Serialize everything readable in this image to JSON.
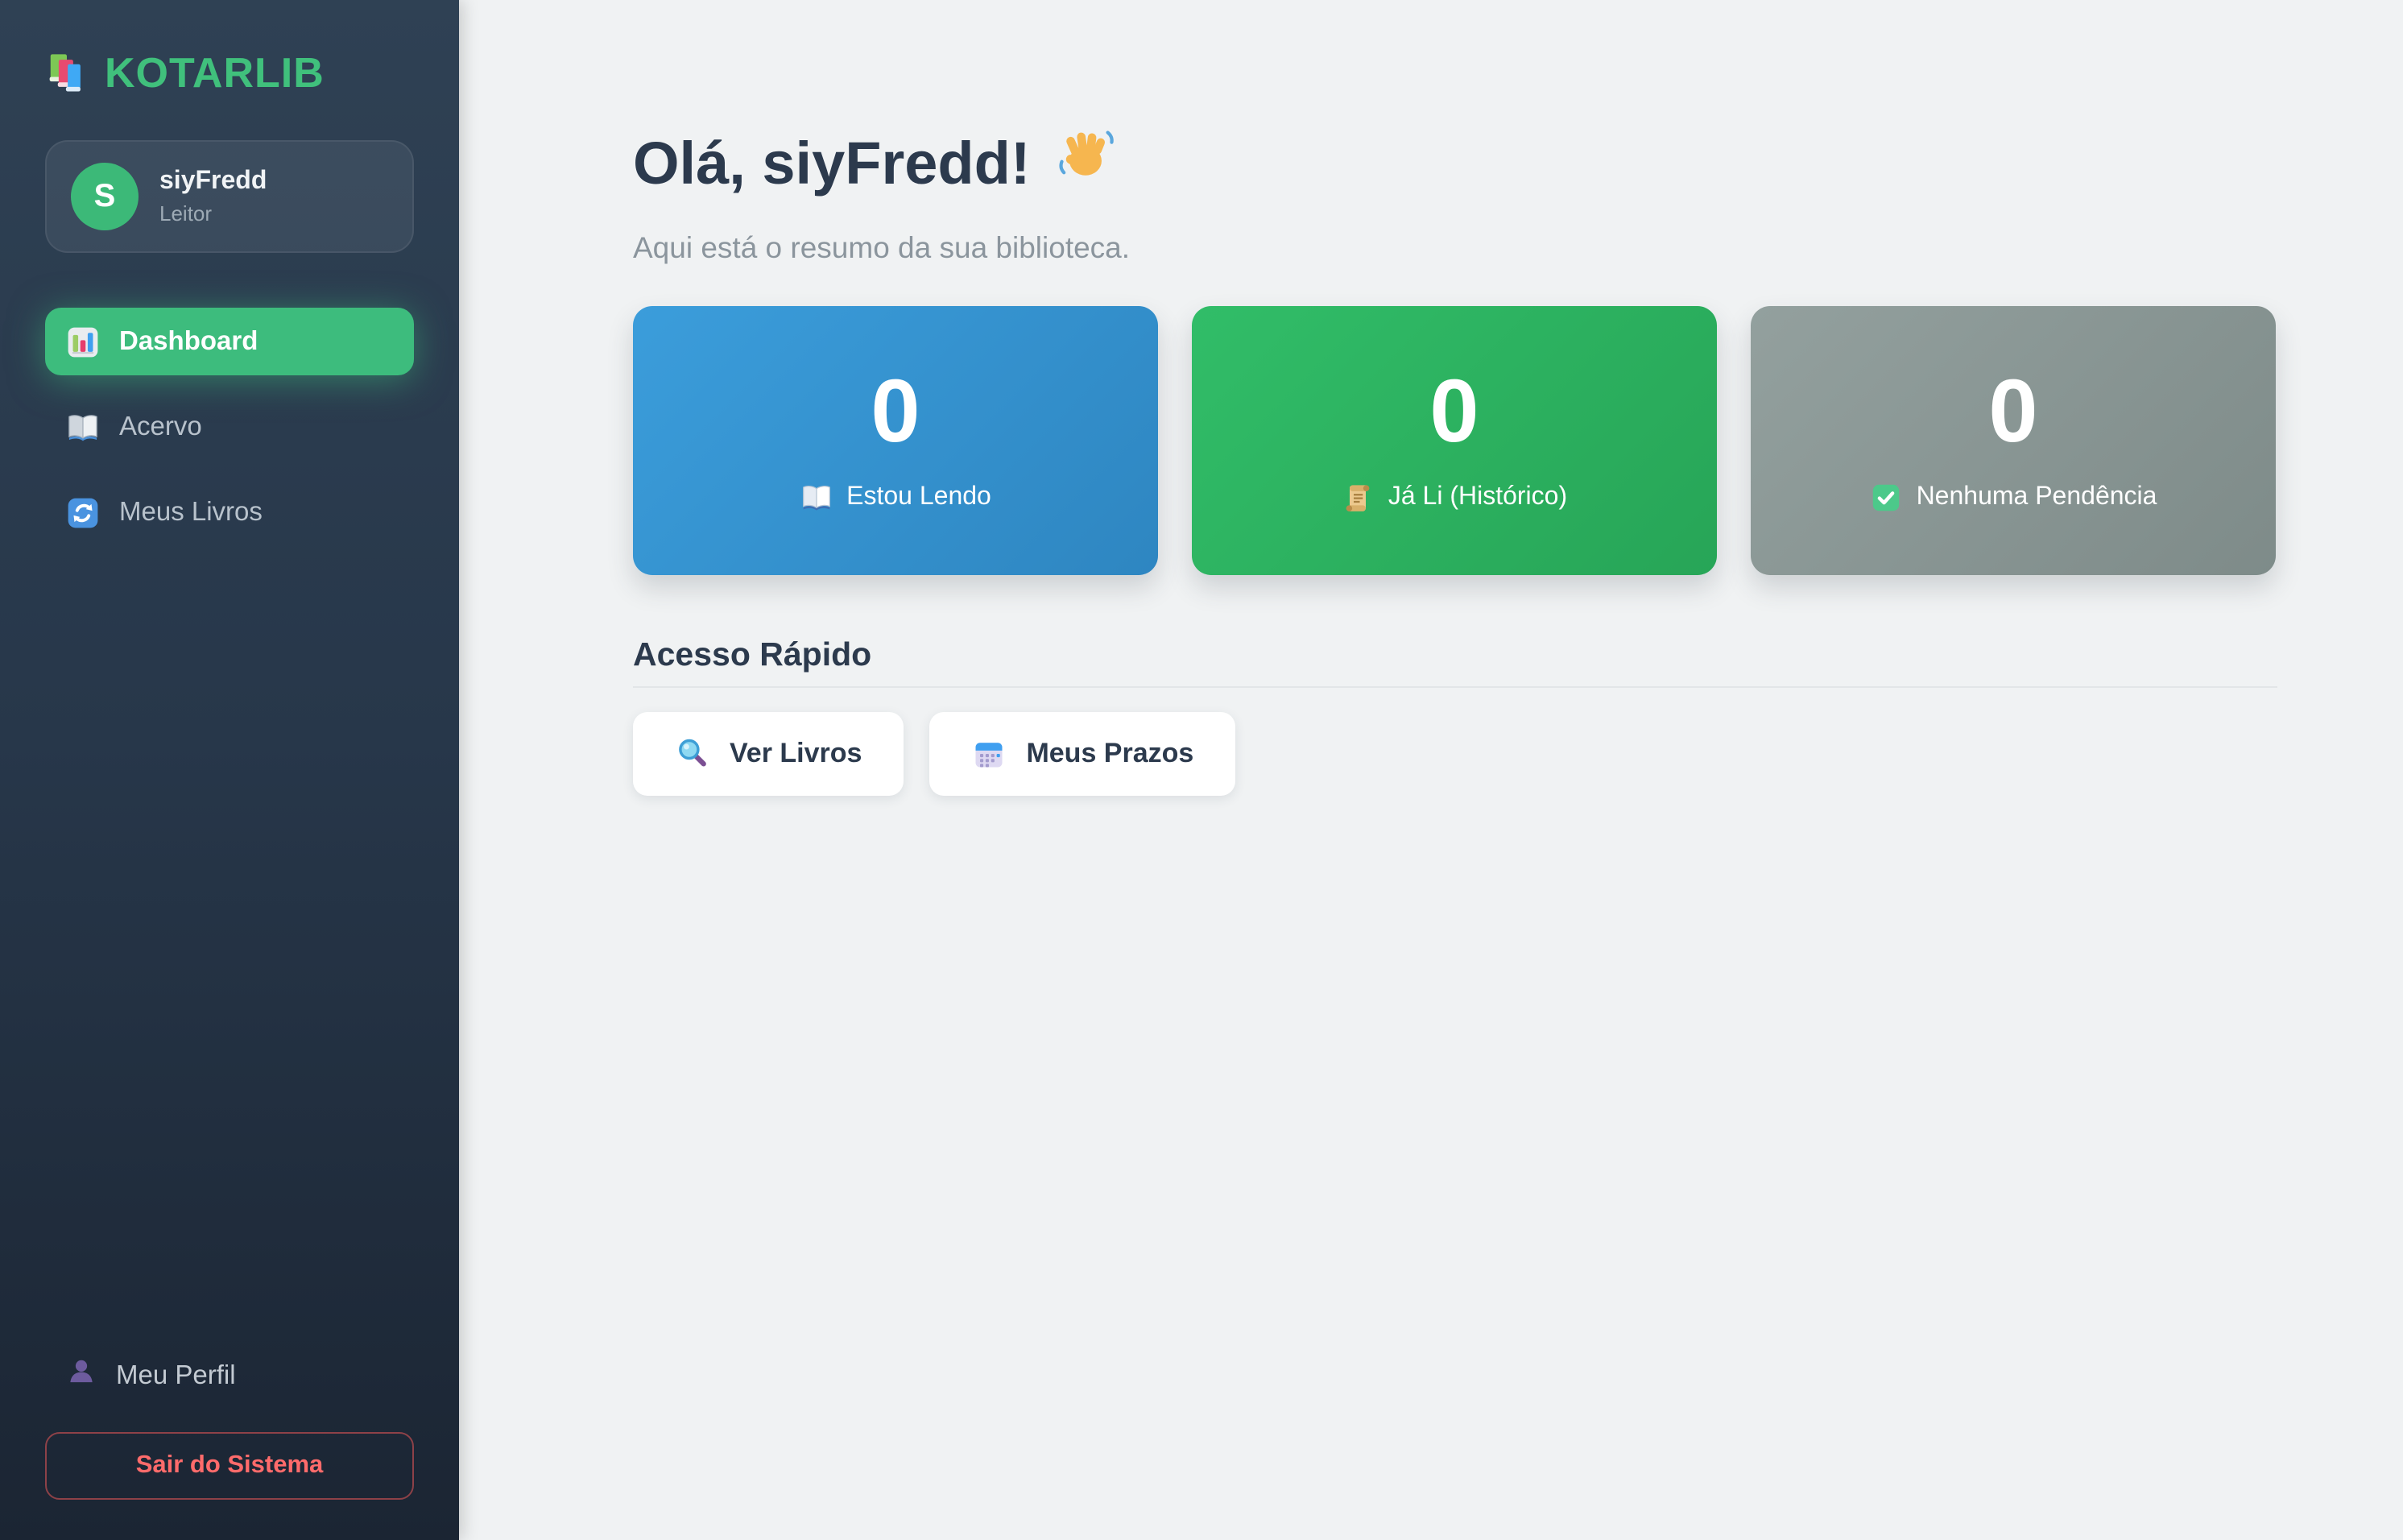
{
  "app": {
    "name": "KOTARLIB",
    "logo_icon": "books-stack-icon"
  },
  "colors": {
    "brand_green": "#40c07c",
    "active_nav_green": "#3dbc7d",
    "avatar_green": "#3cb978",
    "card_blue": "#2e86c1",
    "card_green": "#27a557",
    "card_gray": "#7e8b89",
    "logout_red": "#ff6b6b",
    "sidebar_top": "#2f4154",
    "sidebar_bottom": "#1b2533",
    "main_background": "#f0f2f3",
    "heading_text": "#2c3a4d"
  },
  "sidebar": {
    "user": {
      "initial": "S",
      "name": "siyFredd",
      "role": "Leitor"
    },
    "nav": [
      {
        "label": "Dashboard",
        "icon": "bar-chart-icon",
        "active": true
      },
      {
        "label": "Acervo",
        "icon": "open-book-icon",
        "active": false
      },
      {
        "label": "Meus Livros",
        "icon": "sync-icon",
        "active": false
      }
    ],
    "footer": {
      "profile_label": "Meu Perfil",
      "profile_icon": "person-icon",
      "logout_label": "Sair do Sistema"
    }
  },
  "main": {
    "greeting": "Olá, siyFredd!",
    "greeting_icon": "waving-hand-icon",
    "subtitle": "Aqui está o resumo da sua biblioteca.",
    "stats": [
      {
        "value": "0",
        "label": "Estou Lendo",
        "icon": "open-book-icon",
        "color": "blue"
      },
      {
        "value": "0",
        "label": "Já Li (Histórico)",
        "icon": "scroll-icon",
        "color": "green"
      },
      {
        "value": "0",
        "label": "Nenhuma Pendência",
        "icon": "check-icon",
        "color": "gray"
      }
    ],
    "quick_access": {
      "title": "Acesso Rápido",
      "buttons": [
        {
          "label": "Ver Livros",
          "icon": "magnifier-icon"
        },
        {
          "label": "Meus Prazos",
          "icon": "calendar-icon"
        }
      ]
    }
  }
}
